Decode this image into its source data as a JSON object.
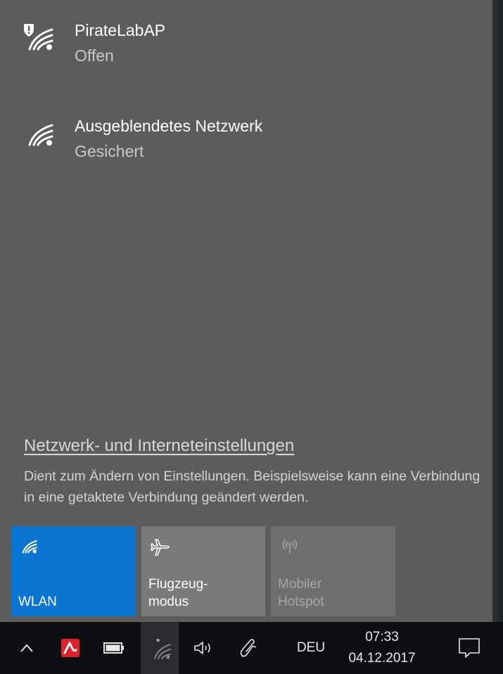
{
  "networks": [
    {
      "name": "PirateLabAP",
      "status": "Offen",
      "icon": "wifi-open-warning-icon"
    },
    {
      "name": "Ausgeblendetes Netzwerk",
      "status": "Gesichert",
      "icon": "wifi-icon"
    }
  ],
  "settings": {
    "link": "Netzwerk- und Interneteinstellungen",
    "description": "Dient zum Ändern von Einstellungen. Beispielsweise kann eine Verbindung in eine getaktete Verbindung geändert werden."
  },
  "quick_actions": {
    "wlan": {
      "label": "WLAN",
      "icon": "wifi-icon",
      "accent": "#0a76d2"
    },
    "flight": {
      "label": "Flugzeug-\nmodus",
      "icon": "airplane-icon"
    },
    "hotspot": {
      "label": "Mobiler\nHotspot",
      "icon": "hotspot-icon"
    }
  },
  "taskbar": {
    "language": "DEU",
    "time": "07:33",
    "date": "04.12.2017",
    "icons": [
      "chevron-up-icon",
      "avira-icon",
      "battery-icon",
      "network-icon",
      "volume-icon",
      "pen-icon",
      "action-center-icon"
    ]
  }
}
